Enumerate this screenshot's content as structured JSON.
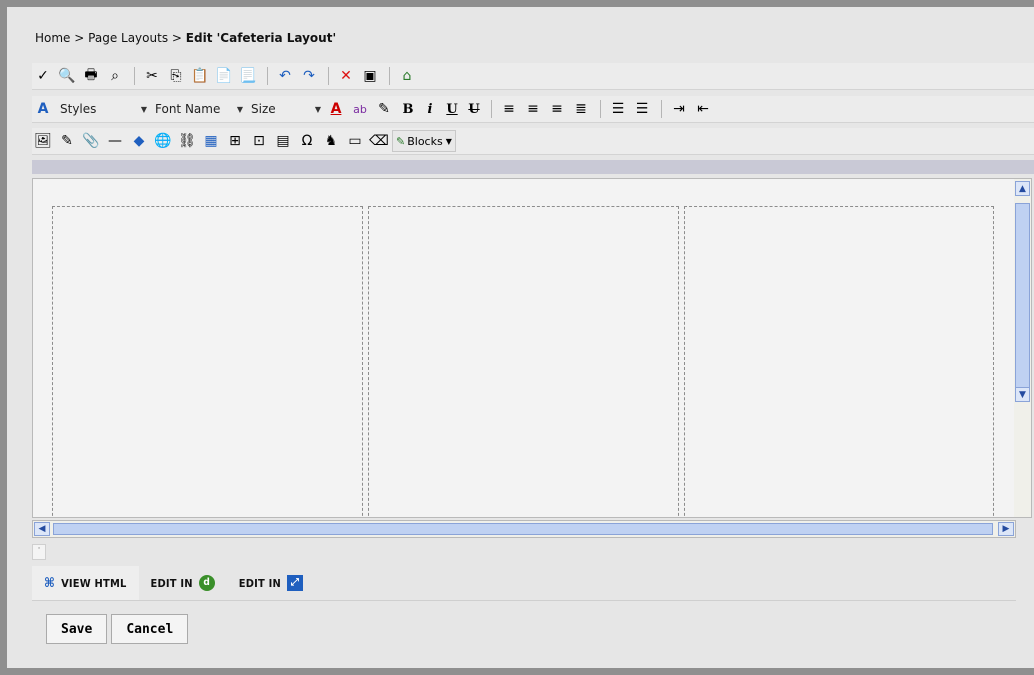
{
  "breadcrumb": {
    "home": "Home",
    "sep1": ">",
    "page_layouts": "Page Layouts",
    "sep2": ">",
    "current": "Edit 'Cafeteria Layout'"
  },
  "toolbar": {
    "styles_label": "Styles",
    "font_name_label": "Font Name",
    "size_label": "Size",
    "bold_glyph": "B",
    "italic_glyph": "i",
    "underline_glyph": "U",
    "strike_glyph": "U",
    "blocks_label": "Blocks"
  },
  "editor": {
    "columns": 3
  },
  "mode_tabs": {
    "view_html": "VIEW HTML",
    "edit_in_1": "EDIT IN",
    "edit_in_2": "EDIT IN"
  },
  "actions": {
    "save": "Save",
    "cancel": "Cancel"
  },
  "colors": {
    "frame": "#8f8f8f",
    "background": "#e6e6e6",
    "scroll_accent": "#bfd1f2"
  }
}
